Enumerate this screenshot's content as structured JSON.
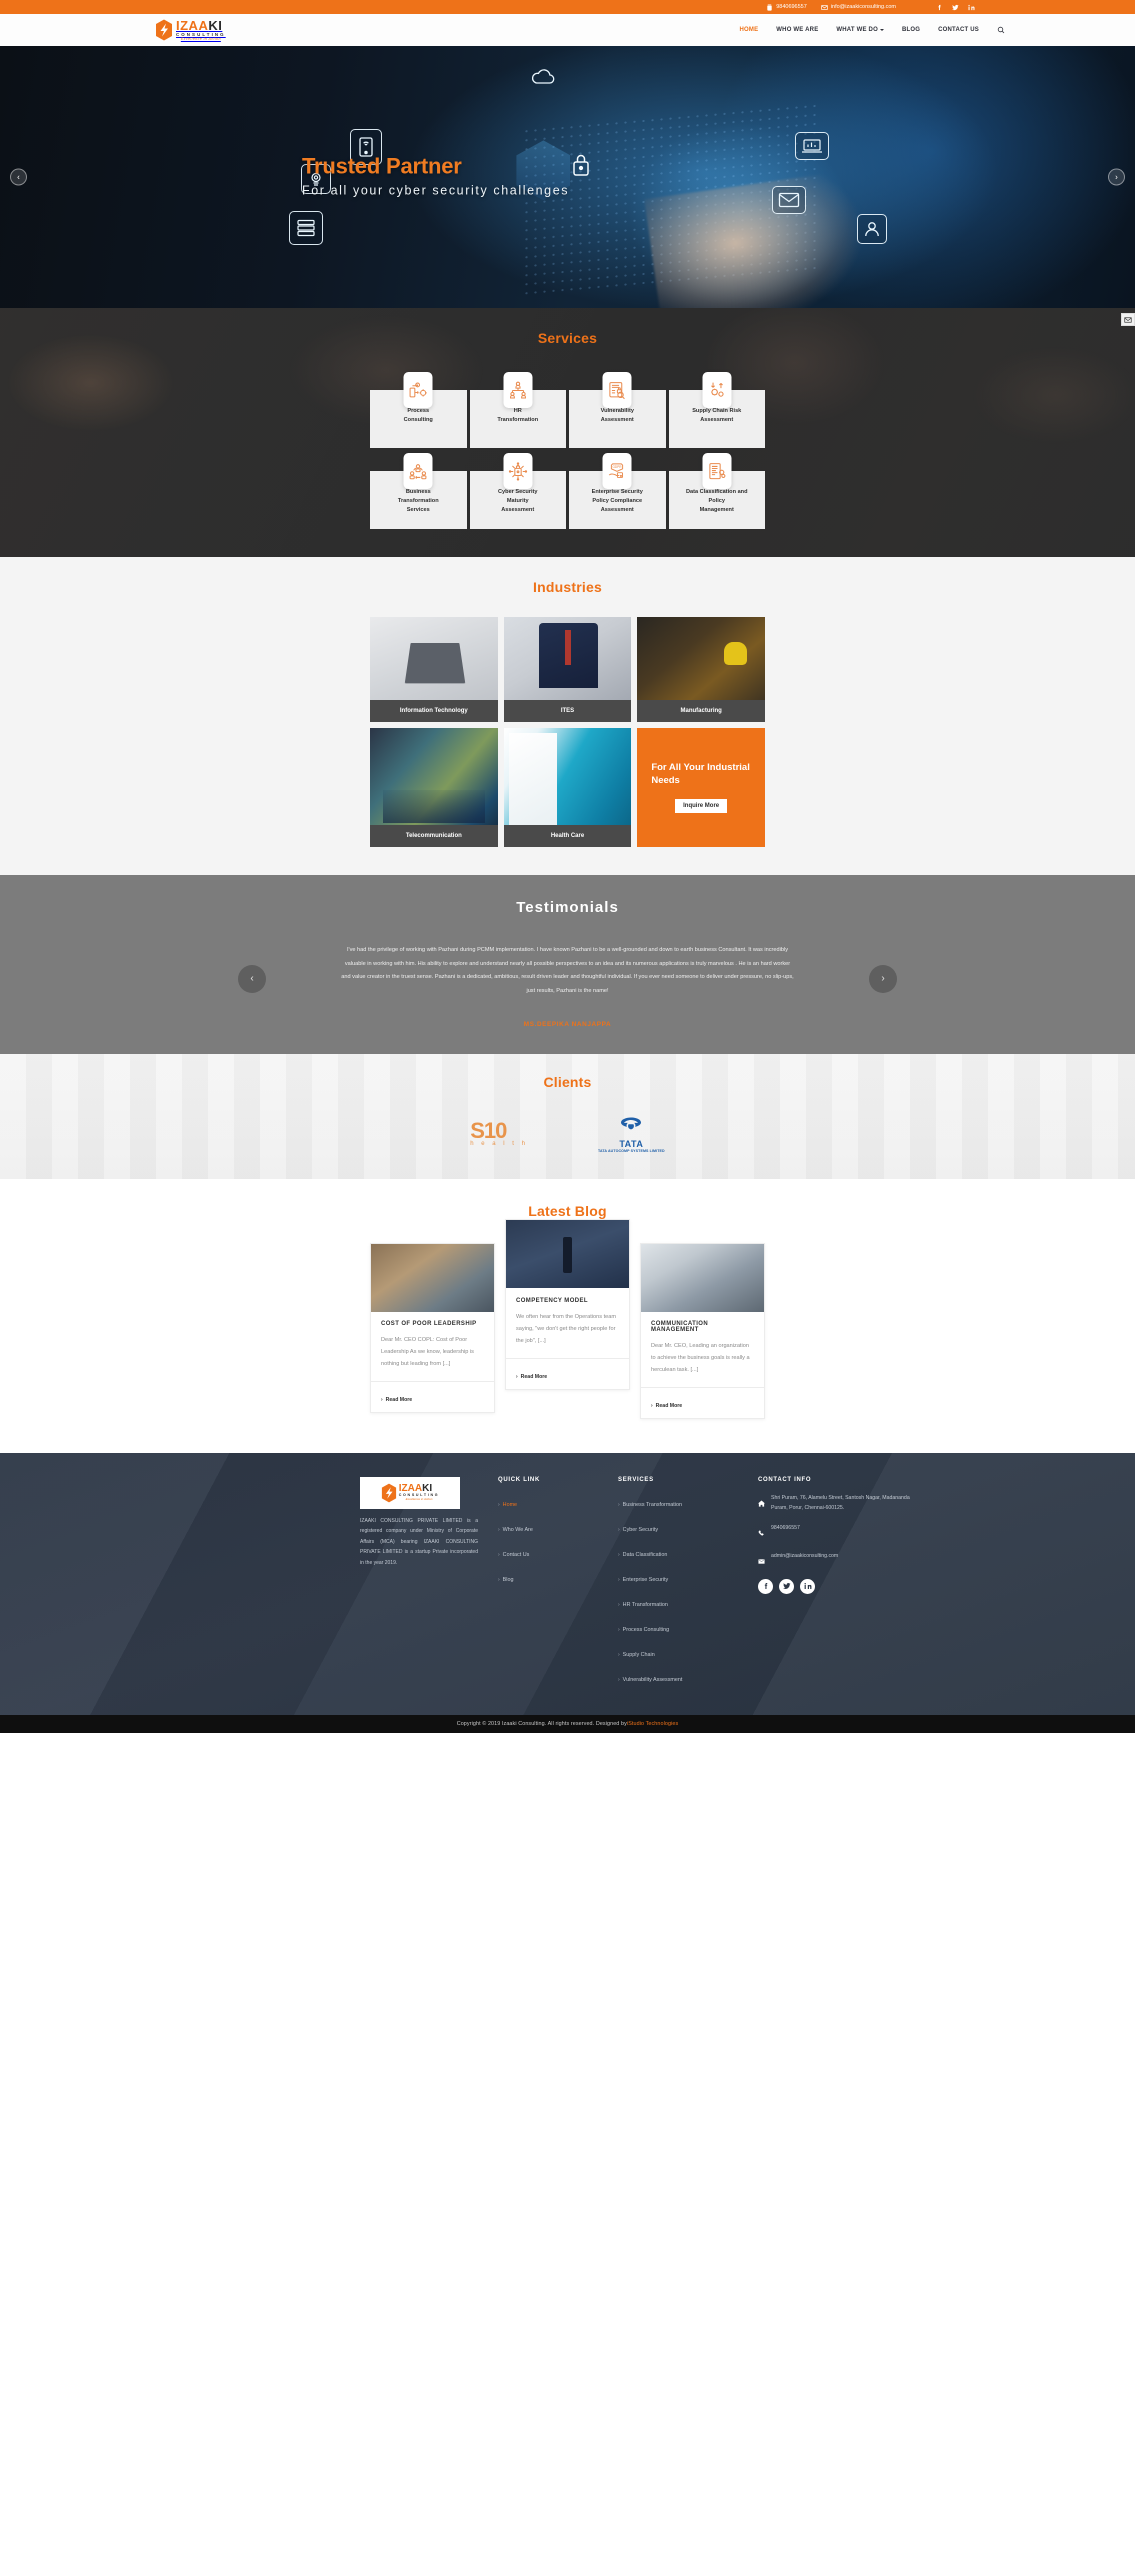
{
  "topbar": {
    "phone": "9840696557",
    "email": "info@izaakiconsulting.com",
    "socials": [
      "facebook",
      "twitter",
      "linkedin"
    ]
  },
  "brand": {
    "name_part1": "IZAA",
    "name_part2": "KI",
    "tagline": "CONSULTING",
    "subtagline": "Excellence in Action"
  },
  "nav": {
    "items": [
      {
        "label": "HOME",
        "active": true,
        "dropdown": false
      },
      {
        "label": "WHO WE ARE",
        "active": false,
        "dropdown": false
      },
      {
        "label": "WHAT WE DO",
        "active": false,
        "dropdown": true
      },
      {
        "label": "BLOG",
        "active": false,
        "dropdown": false
      },
      {
        "label": "CONTACT US",
        "active": false,
        "dropdown": false
      }
    ],
    "search_label": "Search"
  },
  "hero": {
    "title": "Trusted Partner",
    "subtitle": "For all your cyber security challenges",
    "prev_label": "‹",
    "next_label": "›"
  },
  "services": {
    "title": "Services",
    "cards": [
      {
        "label": "Process\nConsulting",
        "icon": "process-consulting-icon"
      },
      {
        "label": "HR\nTransformation",
        "icon": "hr-transformation-icon"
      },
      {
        "label": "Vulnerability\nAssessment",
        "icon": "vulnerability-assessment-icon"
      },
      {
        "label": "Supply Chain Risk\nAssessment",
        "icon": "supply-chain-risk-icon"
      },
      {
        "label": "Business\nTransformation\nServices",
        "icon": "business-transformation-icon"
      },
      {
        "label": "Cyber Security\nMaturity\nAssessment",
        "icon": "cyber-security-maturity-icon"
      },
      {
        "label": "Enterprise Security\nPolicy Compliance\nAssessment",
        "icon": "gdpr-compliance-icon"
      },
      {
        "label": "Data Classification and\nPolicy\nManagement",
        "icon": "data-classification-icon"
      }
    ]
  },
  "industries": {
    "title": "Industries",
    "cards": [
      {
        "label": "Information Technology"
      },
      {
        "label": "ITES"
      },
      {
        "label": "Manufacturing"
      },
      {
        "label": "Telecommunication"
      },
      {
        "label": "Health Care"
      }
    ],
    "cta": {
      "heading": "For All Your Industrial Needs",
      "button": "Inquire More"
    }
  },
  "testimonials": {
    "title": "Testimonials",
    "quote": "I've had the privilege of working with Pazhani during PCMM implementation. I have known Pazhani to be a well-grounded and down to earth business Consultant. It was incredibly valuable in working with him. His ability to explore and understand nearly all possible perspectives to an idea and its numerous applications is truly marvelous . He is an hard worker and value creator in the truest sense. Pazhani is a dedicated, ambitious, result driven leader and thoughtful individual. If you ever need someone to deliver under pressure, no slip-ups, just results, Pazhani is the name!",
    "author": "MS.DEEPIKA NANJAPPA",
    "prev_label": "‹",
    "next_label": "›"
  },
  "clients": {
    "title": "Clients",
    "logos": [
      {
        "name": "S10 health",
        "main": "S10",
        "sub": "h e a l t h"
      },
      {
        "name": "TATA AUTOCOMP SYSTEMS LIMITED",
        "main": "TATA",
        "sub": "TATA AUTOCOMP SYSTEMS LIMITED"
      }
    ]
  },
  "blog": {
    "title": "Latest Blog",
    "posts": [
      {
        "title": "COST OF POOR LEADERSHIP",
        "excerpt": "Dear Mr. CEO COPL: Cost of Poor Leadership As we know, leadership is nothing but leading from [...]",
        "read_more": "Read More"
      },
      {
        "title": "COMPETENCY MODEL",
        "excerpt": "We often hear from the Operations team saying, \"we don't get the right people for the job\", [...]",
        "read_more": "Read More"
      },
      {
        "title": "COMMUNICATION MANAGEMENT",
        "excerpt": "Dear Mr. CEO, Leading an organization to achieve the business goals is really a herculean task. [...]",
        "read_more": "Read More"
      }
    ]
  },
  "footer": {
    "about": "IZAAKI CONSULTING PRIVATE LIMITED is a registered company under Ministry of Corporate Affairs (MCA) bearing IZAAKI CONSULTING PRIVATE LIMITED is a startup Private incorporated in the year 2019.",
    "quick_link": {
      "heading": "QUICK LINK",
      "items": [
        {
          "label": "Home",
          "active": true
        },
        {
          "label": "Who We Are",
          "active": false
        },
        {
          "label": "Contact Us",
          "active": false
        },
        {
          "label": "Blog",
          "active": false
        }
      ]
    },
    "services": {
      "heading": "SERVICES",
      "items": [
        {
          "label": "Business Transformation"
        },
        {
          "label": "Cyber Security"
        },
        {
          "label": "Data Classification"
        },
        {
          "label": "Enterprise Security"
        },
        {
          "label": "HR Transformation"
        },
        {
          "label": "Process Consulting"
        },
        {
          "label": "Supply Chain"
        },
        {
          "label": "Vulnerability Assessment"
        }
      ]
    },
    "contact": {
      "heading": "CONTACT INFO",
      "address": "Shri Puram, 76, Alamelu Street, Santosh Nagar, Madananda Puram, Porur, Chennai-600125.",
      "phone": "9840696557",
      "email": "admin@izaakiconsulting.com",
      "socials": [
        "facebook",
        "twitter",
        "linkedin"
      ]
    }
  },
  "copyright": {
    "text": "Copyright © 2019 Izaaki Consulting. All rights reserved. Designed by ",
    "designer": "iStudio Technologies"
  },
  "colors": {
    "accent": "#ee7219",
    "dark": "#2d3746",
    "services_bg": "#2c2c2c",
    "testimonial_bg": "#7c7c7c"
  }
}
